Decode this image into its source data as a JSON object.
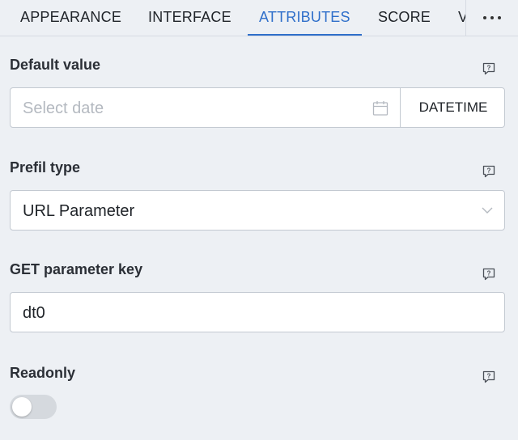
{
  "tabs": [
    {
      "label": "APPEARANCE",
      "active": false
    },
    {
      "label": "INTERFACE",
      "active": false
    },
    {
      "label": "ATTRIBUTES",
      "active": true
    },
    {
      "label": "SCORE",
      "active": false
    },
    {
      "label": "V",
      "active": false
    }
  ],
  "overflow_icon": "more-horizontal-icon",
  "default_value": {
    "label": "Default value",
    "placeholder": "Select date",
    "mode_button": "DATETIME"
  },
  "prefil_type": {
    "label": "Prefil type",
    "selected": "URL Parameter"
  },
  "get_parameter_key": {
    "label": "GET parameter key",
    "value": "dt0"
  },
  "readonly": {
    "label": "Readonly",
    "enabled": false
  },
  "colors": {
    "accent": "#2f6fca",
    "background": "#edf0f4",
    "field_border": "#c3c9d1"
  }
}
